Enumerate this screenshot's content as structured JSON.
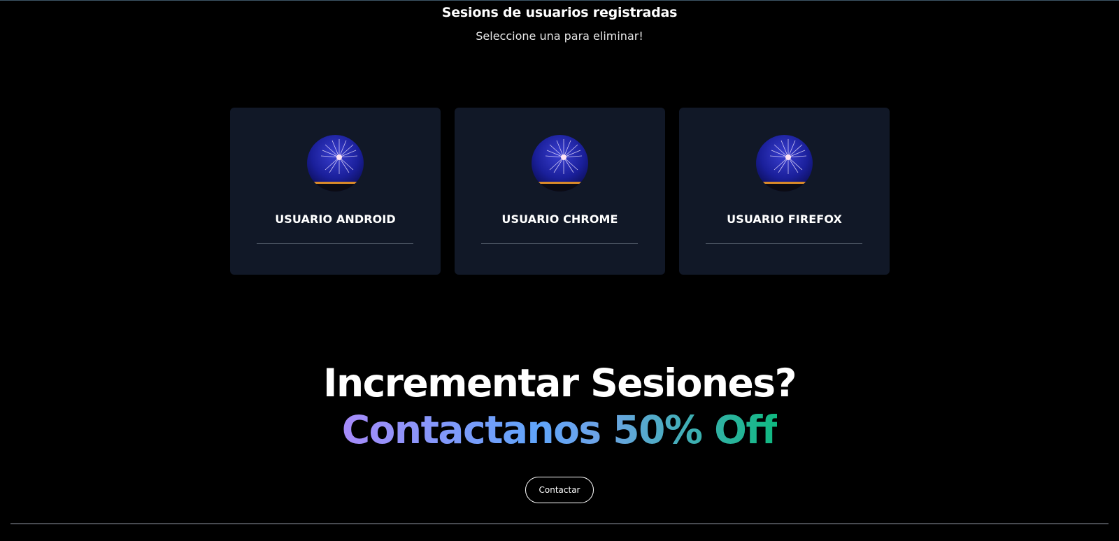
{
  "header": {
    "title": "Sesions de usuarios registradas",
    "subtitle": "Seleccione una para eliminar!"
  },
  "sessions": [
    {
      "name": "USUARIO ANDROID",
      "avatar_icon": "fireworks-avatar"
    },
    {
      "name": "USUARIO CHROME",
      "avatar_icon": "fireworks-avatar"
    },
    {
      "name": "USUARIO FIREFOX",
      "avatar_icon": "fireworks-avatar"
    }
  ],
  "promo": {
    "headline": "Incrementar Sesiones?",
    "offer": "Contactanos 50% Off",
    "button_label": "Contactar"
  },
  "colors": {
    "background": "#000000",
    "card": "#111827",
    "gradient_start": "#a78bfa",
    "gradient_mid": "#60a5fa",
    "gradient_end": "#10b981"
  }
}
